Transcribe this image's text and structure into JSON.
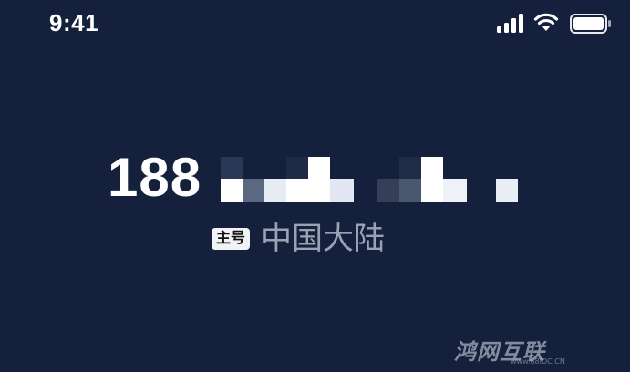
{
  "status_bar": {
    "time": "9:41",
    "icons": [
      "signal-icon",
      "wifi-icon",
      "battery-icon"
    ]
  },
  "phone": {
    "prefix": "188",
    "masked": true
  },
  "line_badge": "主号",
  "region": "中国大陆",
  "watermark": {
    "text": "鸿网互联",
    "sub": "www.68IDC.CN"
  },
  "colors": {
    "background": "#14203c",
    "text": "#ffffff",
    "region_text": "#9aa3b4",
    "badge_bg": "#f2f3f6"
  }
}
